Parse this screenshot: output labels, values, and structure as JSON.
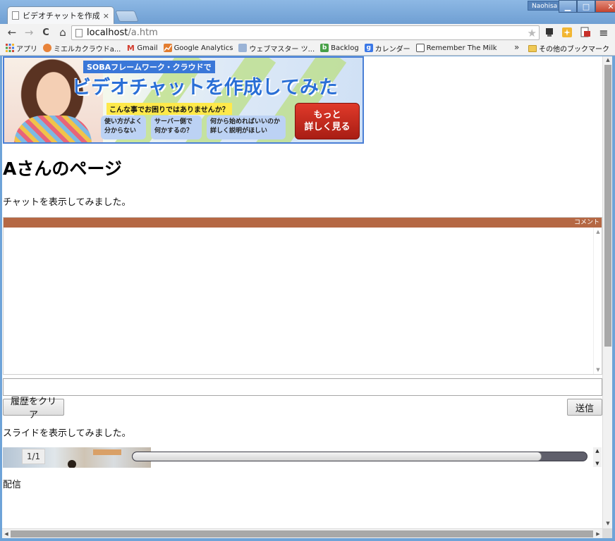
{
  "window": {
    "tab_title": "ビデオチャットを作成し",
    "tab_close": "×",
    "profile_name": "Naohisa",
    "minimize": "▁",
    "maximize": "□",
    "close": "✕"
  },
  "toolbar": {
    "back": "←",
    "forward": "→",
    "reload": "C",
    "home": "⌂",
    "url_host": "localhost",
    "url_path": "/a.htm",
    "star": "★",
    "menu": "≡"
  },
  "bookmarks": {
    "items": [
      {
        "label": "アプリ",
        "icon": "apps-grid-icon",
        "color": "#d04a3a"
      },
      {
        "label": "ミエルカクラウドa...",
        "icon": "cloud-icon",
        "color": "#e8833a"
      },
      {
        "label": "Gmail",
        "icon": "gmail-icon",
        "color": "#d33b2c"
      },
      {
        "label": "Google Analytics",
        "icon": "analytics-icon",
        "color": "#e37c2e"
      },
      {
        "label": "ウェブマスター ツ...",
        "icon": "webmaster-icon",
        "color": "#5a8fd8"
      },
      {
        "label": "Backlog",
        "icon": "backlog-icon",
        "color": "#47a047"
      },
      {
        "label": "カレンダー",
        "icon": "google-calendar-icon",
        "color": "#3b78e7"
      },
      {
        "label": "Remember The Milk",
        "icon": "cow-icon",
        "color": "#555555"
      }
    ],
    "more": "»",
    "other": "その他のブックマーク"
  },
  "banner": {
    "kicker": "SOBAフレームワーク・クラウドで",
    "headline": "ビデオチャットを作成してみた",
    "question": "こんな事でお困りではありませんか？",
    "bubbles": [
      {
        "line1": "使い方がよく",
        "line2": "分からない"
      },
      {
        "line1": "サーバー側で",
        "line2": "何かするの？"
      },
      {
        "line1": "何から始めればいいのか",
        "line2": "詳しく説明がほしい"
      }
    ],
    "cta_line1": "もっと",
    "cta_line2": "詳しく見る"
  },
  "page": {
    "heading": "Aさんのページ",
    "chat_intro": "チャットを表示してみました。",
    "chat_header": "コメント",
    "clear_button": "履歴をクリア",
    "send_button": "送信",
    "slide_intro": "スライドを表示してみました。",
    "slide_counter": "1/1",
    "slide_progress": 0.9,
    "stream_label": "配信"
  }
}
